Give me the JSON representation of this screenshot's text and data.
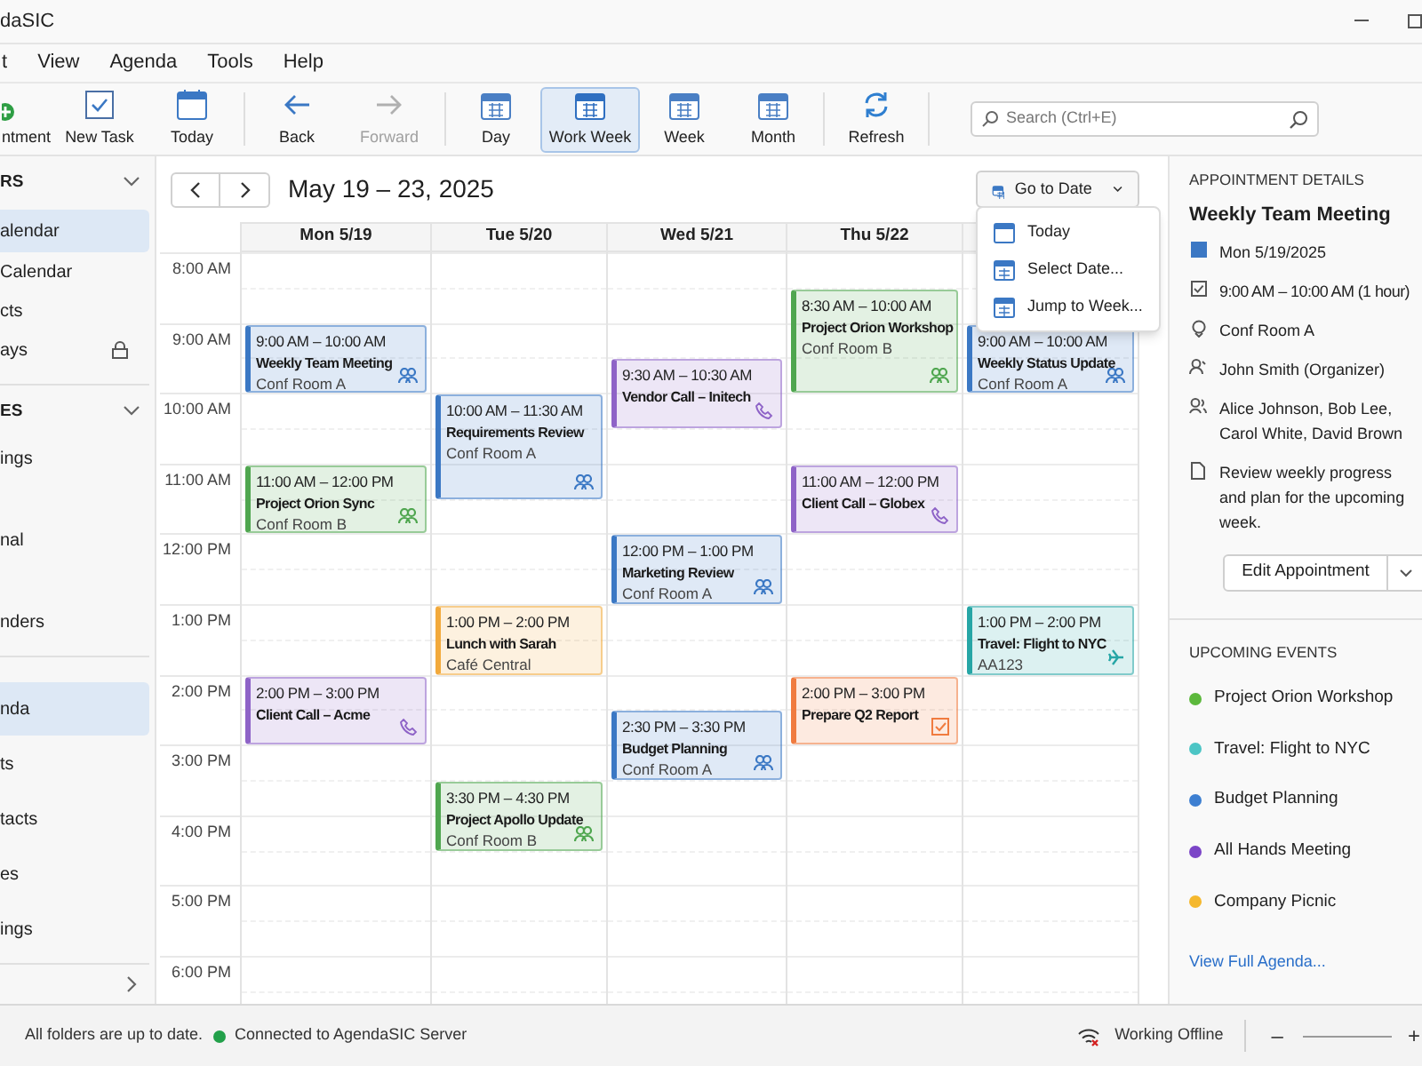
{
  "window": {
    "title": "daSIC"
  },
  "menu": [
    "t",
    "View",
    "Agenda",
    "Tools",
    "Help"
  ],
  "toolbar": {
    "actions": [
      {
        "kind": "new-appointment",
        "label": "ntment"
      },
      {
        "kind": "new-task",
        "label": "New Task"
      },
      {
        "kind": "today",
        "label": "Today"
      }
    ],
    "history": [
      {
        "kind": "back",
        "label": "Back",
        "disabled": false
      },
      {
        "kind": "forward",
        "label": "Forward",
        "disabled": true
      }
    ],
    "views": [
      {
        "label": "Day",
        "selected": false
      },
      {
        "label": "Work Week",
        "selected": true
      },
      {
        "label": "Week",
        "selected": false
      },
      {
        "label": "Month",
        "selected": false
      }
    ],
    "refresh": "Refresh"
  },
  "search": {
    "placeholder": "Search (Ctrl+E)"
  },
  "sidebar": {
    "groups": [
      {
        "title": "RS",
        "expanded": true,
        "items": [
          {
            "label": "alendar",
            "selected": true,
            "locked": false
          },
          {
            "label": "Calendar",
            "selected": false,
            "locked": false
          },
          {
            "label": "cts",
            "selected": false,
            "locked": false
          },
          {
            "label": "ays",
            "selected": false,
            "locked": true
          }
        ]
      },
      {
        "title": "ES",
        "expanded": true,
        "items": [
          {
            "label": "ings",
            "selected": false,
            "locked": false
          },
          {
            "label": "nal",
            "selected": false,
            "locked": false
          },
          {
            "label": "nders",
            "selected": false,
            "locked": false
          }
        ]
      }
    ],
    "nav": [
      {
        "label": "nda",
        "selected": true
      },
      {
        "label": "ts",
        "selected": false
      },
      {
        "label": "tacts",
        "selected": false
      },
      {
        "label": "es",
        "selected": false
      },
      {
        "label": "ings",
        "selected": false
      }
    ]
  },
  "calendar": {
    "range": "May 19 – 23, 2025",
    "go_to_date": {
      "label": "Go to Date",
      "expanded": true
    },
    "go_to_menu": [
      {
        "kind": "today",
        "label": "Today"
      },
      {
        "kind": "select",
        "label": "Select Date..."
      },
      {
        "kind": "week",
        "label": "Jump to Week..."
      }
    ],
    "hours": [
      "8:00 AM",
      "9:00 AM",
      "10:00 AM",
      "11:00 AM",
      "12:00 PM",
      "1:00 PM",
      "2:00 PM",
      "3:00 PM",
      "4:00 PM",
      "5:00 PM",
      "6:00 PM"
    ],
    "columns": [
      {
        "header": "Mon 5/19",
        "events": [
          {
            "time": "9:00 AM – 10:00 AM",
            "title": "Weekly Team Meeting",
            "location": "Conf Room A",
            "kind": "meeting",
            "color": "#3b78c4"
          },
          {
            "time": "11:00 AM – 12:00 PM",
            "title": "Project Orion Sync",
            "location": "Conf Room B",
            "kind": "meeting",
            "color": "#4fa64f"
          },
          {
            "time": "2:00 PM – 3:00 PM",
            "title": "Client Call – Acme",
            "kind": "call",
            "color": "#8e63c7"
          }
        ]
      },
      {
        "header": "Tue 5/20",
        "events": [
          {
            "time": "10:00 AM – 11:30 AM",
            "title": "Requirements Review",
            "location": "Conf Room A",
            "kind": "meeting",
            "color": "#3b78c4"
          },
          {
            "time": "1:00 PM – 2:00 PM",
            "title": "Lunch with Sarah",
            "location": "Café Central",
            "kind": "plain",
            "color": "#f2a93b"
          },
          {
            "time": "3:30 PM – 4:30 PM",
            "title": "Project Apollo Update",
            "location": "Conf Room B",
            "kind": "meeting",
            "color": "#4fa64f"
          }
        ]
      },
      {
        "header": "Wed 5/21",
        "events": [
          {
            "time": "9:30 AM – 10:30 AM",
            "title": "Vendor Call – Initech",
            "kind": "call",
            "color": "#8e63c7"
          },
          {
            "time": "12:00 PM – 1:00 PM",
            "title": "Marketing Review",
            "location": "Conf Room A",
            "kind": "meeting",
            "color": "#3b78c4"
          },
          {
            "time": "2:30 PM – 3:30 PM",
            "title": "Budget Planning",
            "location": "Conf Room A",
            "kind": "meeting",
            "color": "#3b78c4"
          }
        ]
      },
      {
        "header": "Thu 5/22",
        "events": [
          {
            "time": "8:30 AM – 10:00 AM",
            "title": "Project Orion Workshop",
            "location": "Conf Room B",
            "kind": "meeting",
            "color": "#4fa64f"
          },
          {
            "time": "11:00 AM – 12:00 PM",
            "title": "Client Call – Globex",
            "kind": "call",
            "color": "#8e63c7"
          },
          {
            "time": "2:00 PM – 3:00 PM",
            "title": "Prepare Q2 Report",
            "kind": "task",
            "color": "#f07b3f"
          }
        ]
      },
      {
        "events": [
          {
            "time": "9:00 AM – 10:00 AM",
            "title": "Weekly Status Update",
            "location": "Conf Room A",
            "kind": "meeting",
            "color": "#3b78c4"
          },
          {
            "time": "1:00 PM – 2:00 PM",
            "title": "Travel: Flight to NYC",
            "location": "AA123",
            "kind": "travel",
            "color": "#26a6a6"
          }
        ]
      }
    ]
  },
  "details": {
    "heading": "APPOINTMENT DETAILS",
    "title": "Weekly Team Meeting",
    "color": "#3b78c4",
    "rows": [
      {
        "kind": "date",
        "text": "Mon 5/19/2025"
      },
      {
        "kind": "time",
        "text": "9:00 AM – 10:00 AM (1 hour)"
      },
      {
        "kind": "location",
        "text": "Conf Room A"
      },
      {
        "kind": "organizer",
        "text": "John Smith (Organizer)"
      },
      {
        "kind": "attendees",
        "text": "Alice Johnson, Bob Lee, Carol White, David Brown"
      },
      {
        "kind": "notes",
        "text": "Review weekly progress and plan for the upcoming week."
      }
    ],
    "button": "Edit Appointment"
  },
  "upcoming": {
    "heading": "UPCOMING EVENTS",
    "items": [
      {
        "label": "Project Orion Workshop",
        "color": "#5cb83c"
      },
      {
        "label": "Travel: Flight to NYC",
        "color": "#4cc5c5"
      },
      {
        "label": "Budget Planning",
        "color": "#3d7fd1"
      },
      {
        "label": "All Hands Meeting",
        "color": "#7b45c7"
      },
      {
        "label": "Company Picnic",
        "color": "#f5b82e"
      }
    ],
    "link": "View Full Agenda..."
  },
  "status": {
    "sync": "All folders are up to date.",
    "connection": {
      "label": "Connected to AgendaSIC Server",
      "connected": true
    },
    "offline": "Working Offline",
    "zoom_out": "–",
    "zoom_in": "+"
  }
}
